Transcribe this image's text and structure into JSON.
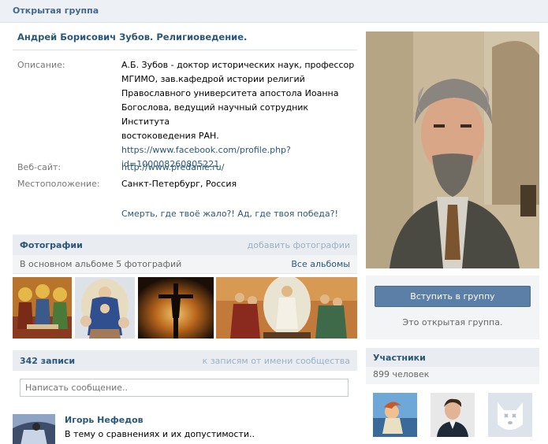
{
  "header": {
    "title": "Открытая группа"
  },
  "group": {
    "name": "Андрей Борисович Зубов. Религиоведение.",
    "description_label": "Описание:",
    "description_lines": [
      "А.Б. Зубов - доктор исторических наук, профессор",
      "МГИМО, зав.кафедрой истории религий",
      "Православного университета апостола Иоанна",
      "Богослова, ведущий научный сотрудник Института",
      "востоковедения РАН."
    ],
    "description_link_lines": [
      "https://www.facebook.com/profile.php?",
      "id=100008260805221"
    ],
    "website_label": "Веб-сайт:",
    "website": "http://www.predanie.ru/",
    "location_label": "Местоположение:",
    "location": "Санкт-Петербург, Россия",
    "status": "Смерть, где твоё жало?! Ад, где твоя победа?!"
  },
  "photos": {
    "title": "Фотографии",
    "add_label": "добавить фотографии",
    "album_info": "В основном альбоме 5 фотографий",
    "all_albums": "Все альбомы",
    "thumbs": [
      "trinity-icon",
      "madonna-painting",
      "crucifix-sunset",
      "resurrection-icon"
    ]
  },
  "wall": {
    "count_label": "342 записи",
    "community_posts": "к записям от имени сообщества",
    "input_placeholder": "Написать сообщение..",
    "post": {
      "author": "Игорь Нефедов",
      "text": "В тему о сравнениях и их допустимости.."
    }
  },
  "side": {
    "join_button": "Вступить в группу",
    "join_note": "Это открытая группа.",
    "members_title": "Участники",
    "members_count": "899 человек"
  },
  "colors": {
    "link": "#2b587a",
    "header_bg": "#edf1f5",
    "button": "#5b7fa6"
  }
}
